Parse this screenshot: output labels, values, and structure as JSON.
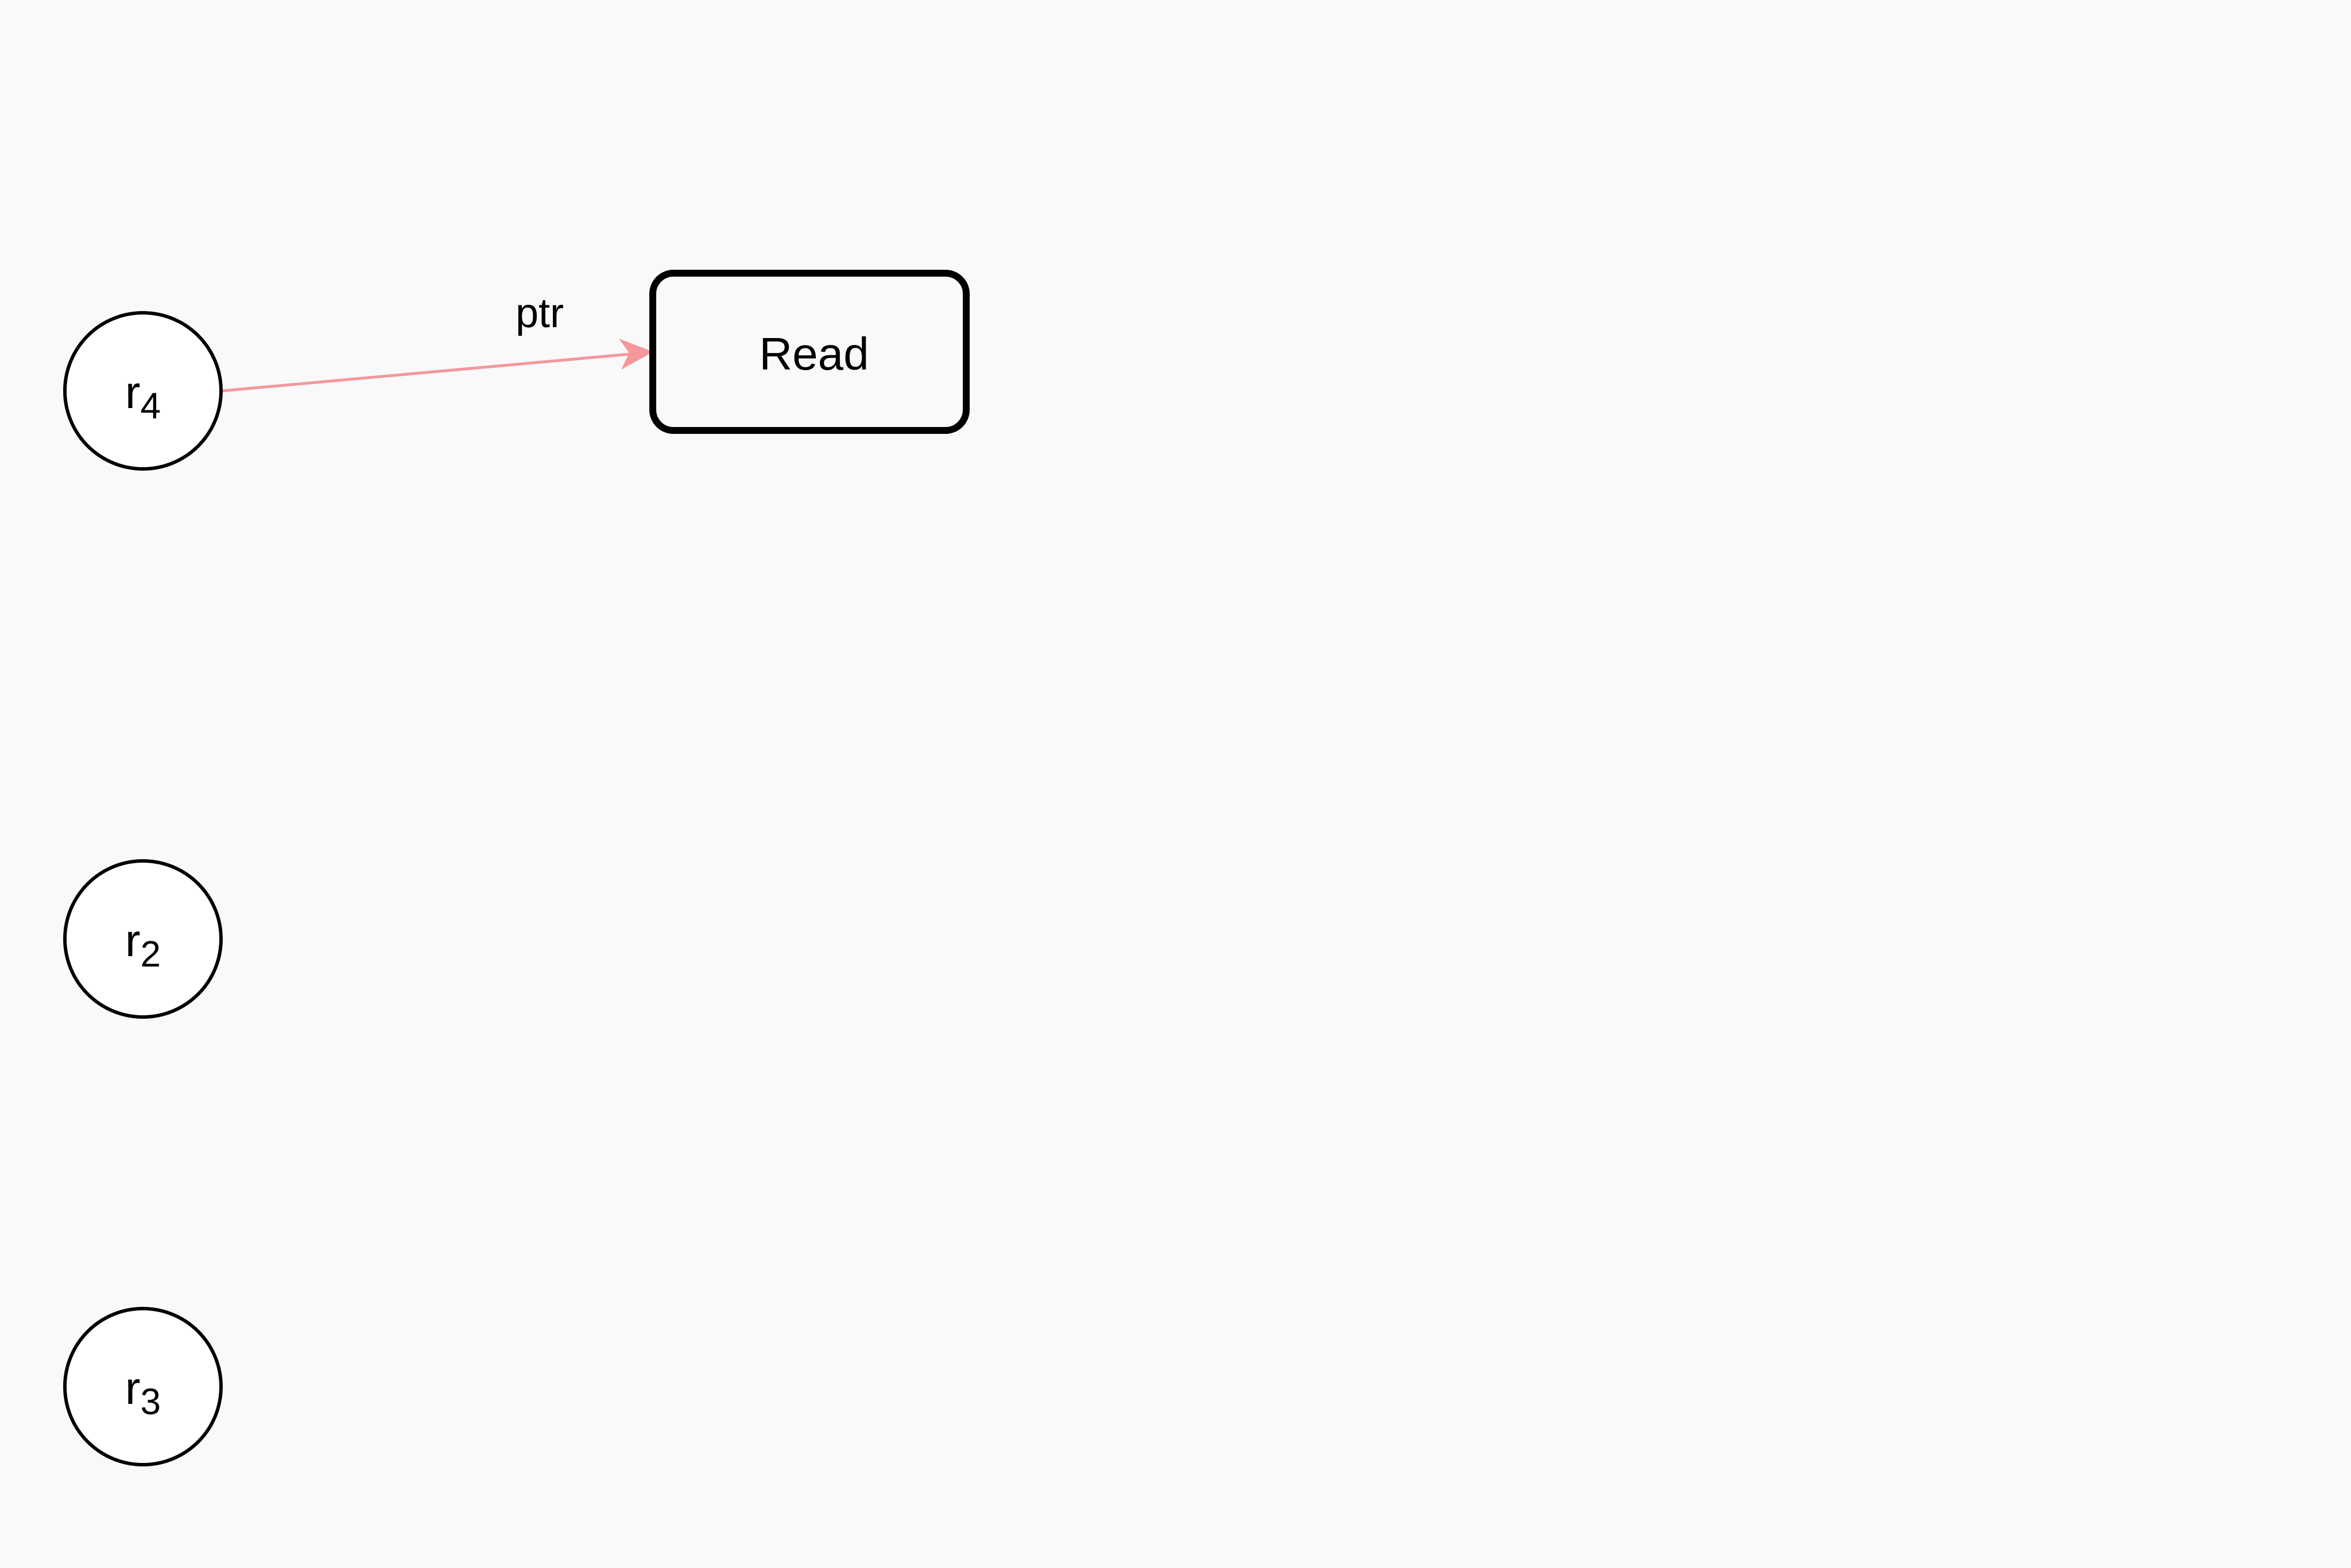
{
  "colors": {
    "background": "#f9f9f9",
    "node_stroke": "#000000",
    "node_fill": "#ffffff",
    "edge": "#f4989b"
  },
  "nodes": {
    "r4": {
      "base": "r",
      "sub": "4"
    },
    "r2": {
      "base": "r",
      "sub": "2"
    },
    "r3": {
      "base": "r",
      "sub": "3"
    },
    "read": {
      "label": "Read"
    }
  },
  "edges": [
    {
      "from": "r4",
      "to": "read",
      "label": "ptr"
    }
  ]
}
